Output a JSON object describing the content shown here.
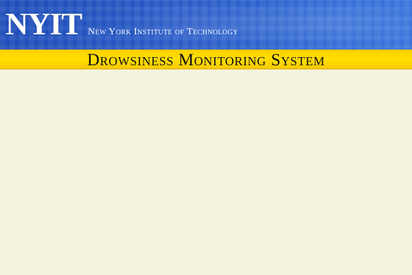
{
  "header": {
    "logo_text": "NYIT",
    "institution_name": "New York Institute of Technology"
  },
  "title_bar": {
    "title": "Drowsiness Monitoring System"
  },
  "colors": {
    "header_blue": "#2a5cc8",
    "title_yellow": "#ffdf00",
    "content_background": "#f5f3dc"
  }
}
